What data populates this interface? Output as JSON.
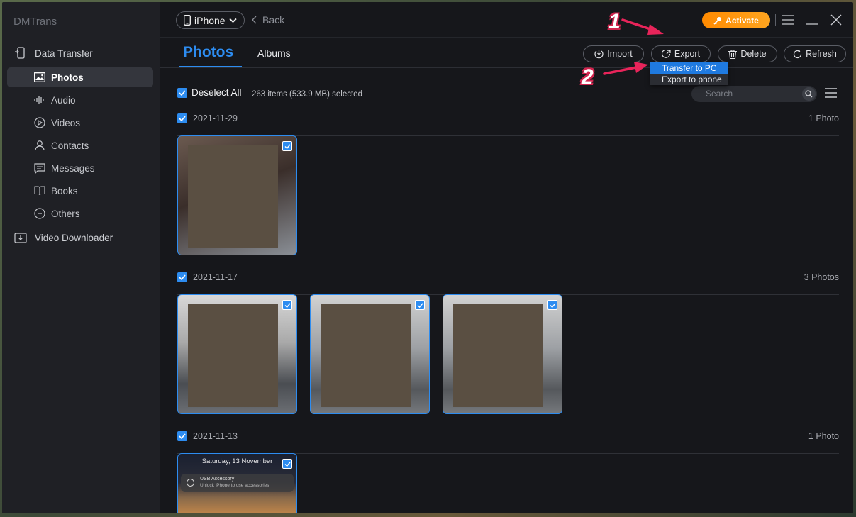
{
  "app": {
    "name": "DMTrans"
  },
  "sidebar": {
    "data_transfer": "Data Transfer",
    "items": [
      {
        "label": "Photos",
        "icon": "photo-icon",
        "active": true
      },
      {
        "label": "Audio",
        "icon": "audio-icon"
      },
      {
        "label": "Videos",
        "icon": "video-icon"
      },
      {
        "label": "Contacts",
        "icon": "contacts-icon"
      },
      {
        "label": "Messages",
        "icon": "messages-icon"
      },
      {
        "label": "Books",
        "icon": "book-icon"
      },
      {
        "label": "Others",
        "icon": "others-icon"
      }
    ],
    "video_downloader": "Video Downloader"
  },
  "header": {
    "device": "iPhone",
    "back": "Back",
    "activate": "Activate"
  },
  "tabs": {
    "photos": "Photos",
    "albums": "Albums"
  },
  "toolbar": {
    "import": "Import",
    "export": "Export",
    "delete": "Delete",
    "refresh": "Refresh"
  },
  "export_menu": {
    "transfer_to_pc": "Transfer to PC",
    "export_to_phone": "Export to phone"
  },
  "selection": {
    "deselect_all": "Deselect All",
    "info": "263 items (533.9 MB) selected"
  },
  "search": {
    "placeholder": "Search"
  },
  "groups": [
    {
      "date": "2021-11-29",
      "count": "1 Photo"
    },
    {
      "date": "2021-11-17",
      "count": "3 Photos"
    },
    {
      "date": "2021-11-13",
      "count": "1 Photo"
    }
  ],
  "lockscreen": {
    "date": "Saturday, 13 November",
    "notif_title": "USB Accessory",
    "notif_body": "Unlock iPhone to use accessories"
  },
  "annotations": {
    "step1": "1",
    "step2": "2"
  },
  "colors": {
    "accent": "#2d8cf0",
    "activate": "#ff8a00",
    "annotation": "#e8245a"
  }
}
